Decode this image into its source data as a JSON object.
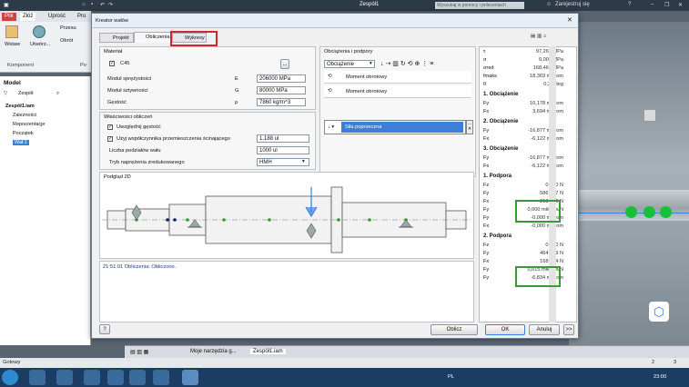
{
  "app": {
    "title": "Zespół1",
    "search_placeholder": "Wyszukaj w pomocy i poleceniach",
    "signin": "Zarejestruj się",
    "ribbon_tabs": [
      "Plik",
      "Złóż",
      "Uprość",
      "Pro"
    ],
    "ribbon_buttons": [
      "Wstaw",
      "Utwórz...",
      "Przesu",
      "Obrót"
    ],
    "ribbon_group": "Komponent",
    "ribbon_group2": "Po"
  },
  "model": {
    "header": "Model",
    "filter": "Zespół",
    "root": "Zespół1.iam",
    "items": [
      "Zależności",
      "Reprezentacje",
      "Początek",
      "Wał:1"
    ]
  },
  "dialog": {
    "title": "Kreator wałów",
    "tabs": [
      "Projekt",
      "Obliczenia",
      "Wykresy"
    ],
    "material": {
      "group": "Materiał",
      "value": "C45",
      "browse": "...",
      "props": [
        {
          "label": "Moduł sprężystości",
          "sym": "E",
          "value": "206000 MPa"
        },
        {
          "label": "Moduł sztywności",
          "sym": "G",
          "value": "80000 MPa"
        },
        {
          "label": "Gęstość",
          "sym": "ρ",
          "value": "7860 kg/m^3"
        }
      ]
    },
    "calc": {
      "group": "Właściwości obliczeń",
      "opt1": "Uwzględnij gęstość",
      "opt2": "Użyj współczynnika przemieszczenia ścinającego",
      "opt2_value": "1,188 ul",
      "divisions_label": "Liczba podziałów wału",
      "divisions_value": "1000 ul",
      "mode_label": "Tryb naprężenia zredukowanego",
      "mode_value": "HMH"
    },
    "loads": {
      "group": "Obciążenia i podpory",
      "selector": "Obciążenie",
      "items": [
        "Moment obrotowy",
        "Moment obrotowy",
        "Siła poprzeczna"
      ]
    },
    "preview_label": "Podgląd 2D",
    "log": "21:51:01 Obliczenia: Obliczono.",
    "buttons": {
      "help": "?",
      "calc": "Oblicz",
      "ok": "OK",
      "cancel": "Anuluj",
      "more": ">>"
    }
  },
  "results": {
    "top": [
      {
        "s": "τ",
        "v": "97,261 MPa"
      },
      {
        "s": "σ",
        "v": "0,000 MPa"
      },
      {
        "s": "σred",
        "v": "168,462 MPa"
      },
      {
        "s": "fmaks",
        "v": "18,303 mikrom"
      },
      {
        "s": "θ",
        "v": "0,26 deg"
      }
    ],
    "sections": [
      {
        "h": "1. Obciążenie",
        "rows": [
          {
            "s": "Fy",
            "v": "10,178 mikrom"
          },
          {
            "s": "Fx",
            "v": "3,694 mikrom"
          }
        ]
      },
      {
        "h": "2. Obciążenie",
        "rows": [
          {
            "s": "Fy",
            "v": "-16,877 mikrom"
          },
          {
            "s": "Fx",
            "v": "-6,122 mikrom"
          }
        ]
      },
      {
        "h": "3. Obciążenie",
        "rows": [
          {
            "s": "Fy",
            "v": "-16,877 mikrom"
          },
          {
            "s": "Fx",
            "v": "-6,122 mikrom"
          }
        ]
      },
      {
        "h": "1. Podpora",
        "rows": [
          {
            "s": "Fz",
            "v": "0,000 N"
          },
          {
            "s": "Fy",
            "v": "586,967 N"
          },
          {
            "s": "Fx",
            "v": "213,346 N"
          },
          {
            "s": "Fy",
            "v": "0,000 mikrom/N"
          },
          {
            "s": "Fy",
            "v": "-0,000 mikrom"
          },
          {
            "s": "Fx",
            "v": "-0,000 mikrom"
          }
        ]
      },
      {
        "h": "2. Podpora",
        "rows": [
          {
            "s": "Fz",
            "v": "0,000 N"
          },
          {
            "s": "Fy",
            "v": "464,329 N"
          },
          {
            "s": "Fx",
            "v": "168,054 N"
          },
          {
            "s": "Fy",
            "v": "0,015 mikrom/N"
          },
          {
            "s": "Fy",
            "v": "-6,834 mikrom"
          }
        ]
      }
    ]
  },
  "bottom_tabs": [
    "Moje narzędzia g...",
    "Zespół1.iam"
  ],
  "status": {
    "left": "Gotowy",
    "n1": "2",
    "n2": "3",
    "time": "23:00",
    "lang": "PL"
  },
  "colors": {
    "highlight_red": "#d0282e",
    "highlight_green": "#3a9a3a",
    "selection": "#3b7fd9",
    "sphere": "#16c03a"
  },
  "icons": [
    "home-icon",
    "save-icon",
    "undo-icon",
    "redo-icon",
    "help-icon",
    "close-icon",
    "arrow-down-icon",
    "plus-icon",
    "rotate-icon",
    "filter-icon",
    "search-icon",
    "cube-icon"
  ]
}
